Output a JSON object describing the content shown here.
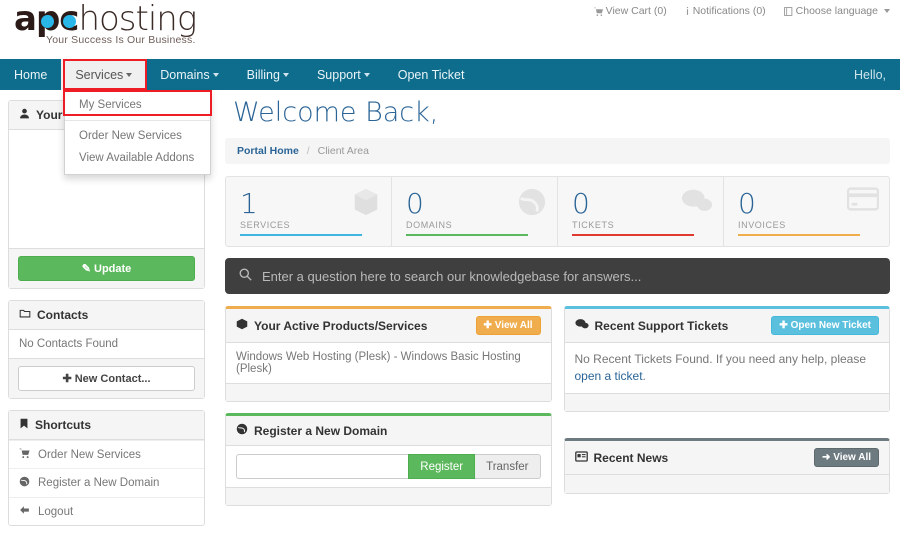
{
  "brand": {
    "name_bold": "apc",
    "name_light": "hosting",
    "tagline": "Your Success Is Our Business.",
    "dot_color": "#29b6e8"
  },
  "topbar": {
    "items": [
      {
        "label": "View Cart (0)",
        "icon": "cart-icon"
      },
      {
        "label": "Notifications (0)",
        "icon": "info-icon"
      },
      {
        "label": "Choose language",
        "icon": "book-icon",
        "caret": true
      }
    ]
  },
  "nav": {
    "items": [
      {
        "label": "Home",
        "caret": false,
        "active": false
      },
      {
        "label": "Services",
        "caret": true,
        "active": true
      },
      {
        "label": "Domains",
        "caret": true,
        "active": false
      },
      {
        "label": "Billing",
        "caret": true,
        "active": false
      },
      {
        "label": "Support",
        "caret": true,
        "active": false
      },
      {
        "label": "Open Ticket",
        "caret": false,
        "active": false
      }
    ],
    "hello": "Hello,",
    "bg_color": "#0e6d8c",
    "highlight_color": "#ee1c24"
  },
  "dropdown": {
    "items": [
      {
        "label": "My Services",
        "highlighted": true
      },
      {
        "label": "Order New Services",
        "highlighted": false
      },
      {
        "label": "View Available Addons",
        "highlighted": false
      }
    ]
  },
  "sidebar": {
    "account_panel": {
      "title": "Your",
      "icon": "user-icon",
      "update_button": "Update"
    },
    "contacts_panel": {
      "title": "Contacts",
      "icon": "folder-icon",
      "empty_text": "No Contacts Found",
      "new_button": "New Contact..."
    },
    "shortcuts_panel": {
      "title": "Shortcuts",
      "icon": "bookmark-icon",
      "items": [
        {
          "label": "Order New Services",
          "icon": "cart-icon"
        },
        {
          "label": "Register a New Domain",
          "icon": "globe-icon"
        },
        {
          "label": "Logout",
          "icon": "arrow-left-icon"
        }
      ]
    }
  },
  "main": {
    "welcome_title": "Welcome Back,",
    "breadcrumb": {
      "home": "Portal Home",
      "separator": "/",
      "current": "Client Area"
    },
    "search": {
      "placeholder": "Enter a question here to search our knowledgebase for answers...",
      "icon": "search-icon"
    },
    "stats": [
      {
        "value": "1",
        "label": "SERVICES",
        "color": "#3fb6e0",
        "icon": "box-icon"
      },
      {
        "value": "0",
        "label": "DOMAINS",
        "color": "#5cb85c",
        "icon": "globe-icon"
      },
      {
        "value": "0",
        "label": "TICKETS",
        "color": "#e0392f",
        "icon": "comments-icon"
      },
      {
        "value": "0",
        "label": "INVOICES",
        "color": "#f0ad4e",
        "icon": "card-icon"
      }
    ],
    "products_panel": {
      "title": "Your Active Products/Services",
      "icon": "box-icon",
      "view_all": "View All",
      "items": [
        "Windows Web Hosting (Plesk) - Windows Basic Hosting (Plesk)"
      ]
    },
    "tickets_panel": {
      "title": "Recent Support Tickets",
      "icon": "comments-icon",
      "action_button": "Open New Ticket",
      "empty_text": "No Recent Tickets Found. If you need any help, please ",
      "empty_link": "open a ticket",
      "empty_tail": "."
    },
    "domain_panel": {
      "title": "Register a New Domain",
      "icon": "globe-icon",
      "input_value": "",
      "register_button": "Register",
      "transfer_button": "Transfer"
    },
    "news_panel": {
      "title": "Recent News",
      "icon": "news-icon",
      "view_all": "View All"
    }
  }
}
